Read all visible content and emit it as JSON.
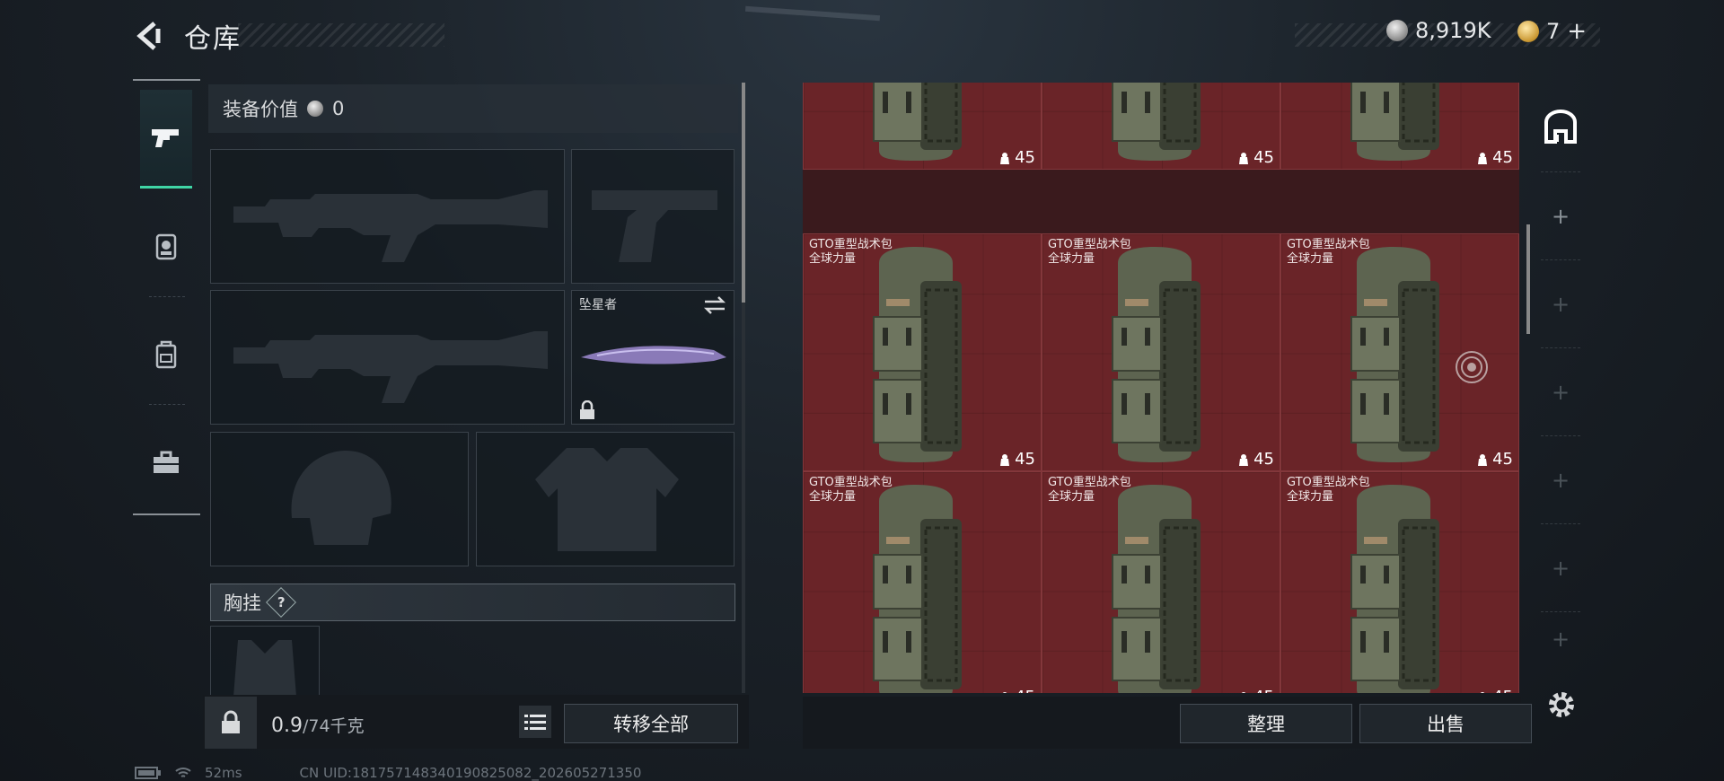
{
  "header": {
    "title": "仓库",
    "silver_amount": "8,919K",
    "gold_amount": "7",
    "gold_add": "+"
  },
  "left_tabs": [
    {
      "name": "pistol-icon",
      "active": true
    },
    {
      "name": "helmet-icon",
      "active": false
    },
    {
      "name": "backpack-icon",
      "active": false
    },
    {
      "name": "toolbox-icon",
      "active": false
    }
  ],
  "loadout": {
    "value_label": "装备价值",
    "value": "0",
    "melee_name": "坠星者",
    "chest_label": "胸挂",
    "chest_help": "?"
  },
  "bottom": {
    "weight_current": "0.9",
    "weight_max": "/74千克",
    "transfer_all": "转移全部",
    "sort": "整理",
    "sell": "出售"
  },
  "grid": {
    "item_name": "GTO重型战术包",
    "item_brand": "全球力量",
    "item_count": "45"
  },
  "status": {
    "ping": "52ms",
    "uid": "CN UID:18175714834019082508​2_202605271350"
  },
  "colors": {
    "accent": "#3fd6a6",
    "cell_bg": "#6a2428"
  }
}
